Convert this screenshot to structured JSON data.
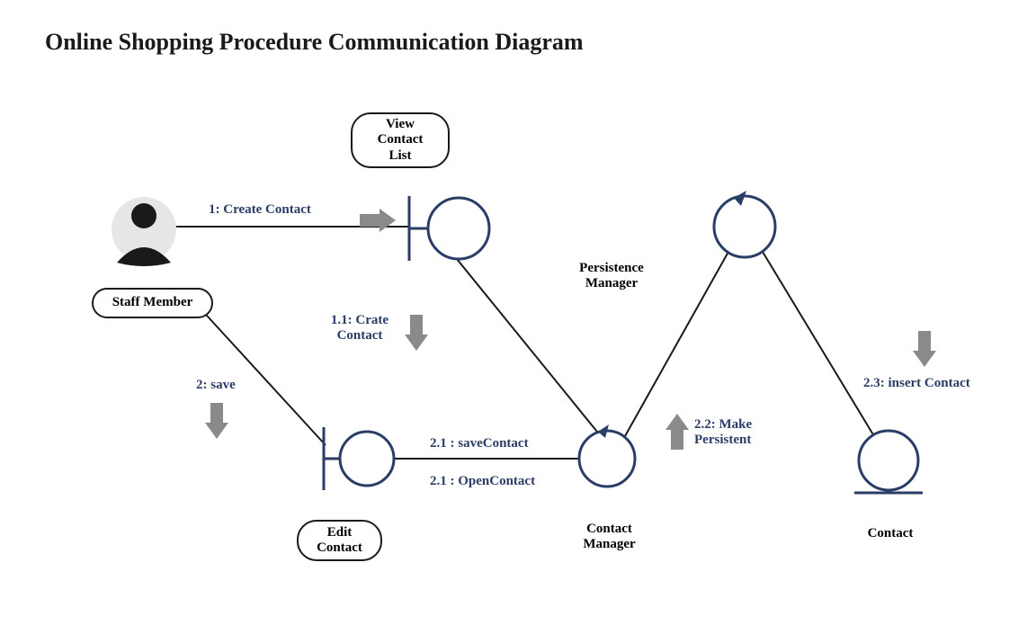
{
  "title": "Online Shopping Procedure Communication Diagram",
  "nodes": {
    "staff_member": "Staff Member",
    "view_contact_list": "View\nContact\nList",
    "edit_contact": "Edit\nContact",
    "contact_manager": "Contact\nManager",
    "persistence_manager": "Persistence\nManager",
    "contact": "Contact"
  },
  "messages": {
    "m1": "1: Create Contact",
    "m1_1": "1.1: Crate\nContact",
    "m2": "2: save",
    "m2_1a": "2.1 : saveContact",
    "m2_1b": "2.1 : OpenContact",
    "m2_2": "2.2: Make\nPersistent",
    "m2_3": "2.3: insert Contact"
  }
}
